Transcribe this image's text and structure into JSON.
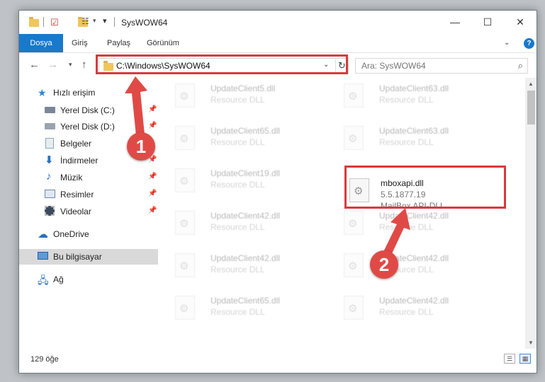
{
  "window": {
    "title": "SysWOW64",
    "minimize": "—",
    "maximize": "☐",
    "close": "✕"
  },
  "ribbon": {
    "tabs": [
      "Dosya",
      "Giriş",
      "Paylaş",
      "Görünüm"
    ],
    "help": "?",
    "expand": "⌄"
  },
  "address": {
    "path": "C:\\Windows\\SysWOW64",
    "search_placeholder": "Ara: SysWOW64"
  },
  "nav": {
    "items": [
      {
        "label": "Hızlı erişim",
        "icon": "star-icon"
      },
      {
        "label": "Yerel Disk (C:)",
        "icon": "drive-icon"
      },
      {
        "label": "Yerel Disk (D:)",
        "icon": "drive-icon"
      },
      {
        "label": "Belgeler",
        "icon": "documents-icon"
      },
      {
        "label": "İndirmeler",
        "icon": "download-icon"
      },
      {
        "label": "Müzik",
        "icon": "music-icon"
      },
      {
        "label": "Resimler",
        "icon": "pictures-icon"
      },
      {
        "label": "Videolar",
        "icon": "video-icon"
      },
      {
        "label": "OneDrive",
        "icon": "cloud-icon"
      },
      {
        "label": "Bu bilgisayar",
        "icon": "computer-icon"
      },
      {
        "label": "Ağ",
        "icon": "network-icon"
      }
    ]
  },
  "files": {
    "left": [
      {
        "name": "UpdateClient5.dll",
        "desc": "Resource DLL"
      },
      {
        "name": "UpdateClient65.dll",
        "desc": "Resource DLL"
      },
      {
        "name": "UpdateClient19.dll",
        "desc": "Resource DLL"
      },
      {
        "name": "UpdateClient42.dll",
        "desc": "Resource DLL"
      },
      {
        "name": "UpdateClient42.dll",
        "desc": "Resource DLL"
      },
      {
        "name": "UpdateClient65.dll",
        "desc": "Resource DLL"
      }
    ],
    "right": [
      {
        "name": "UpdateClient63.dll",
        "desc": "Resource DLL"
      },
      {
        "name": "UpdateClient63.dll",
        "desc": "Resource DLL"
      },
      {
        "name": "mboxapi.dll",
        "version": "5.5.1877.19",
        "desc": "MailBox API-DLL"
      },
      {
        "name": "UpdateClient42.dll",
        "desc": "Resource DLL"
      },
      {
        "name": "UpdateClient42.dll",
        "desc": "Resource DLL"
      },
      {
        "name": "UpdateClient42.dll",
        "desc": "Resource DLL"
      }
    ]
  },
  "status": {
    "count": "129 öğe"
  },
  "annotations": {
    "badge1": "1",
    "badge2": "2",
    "color": "#d73b3b"
  }
}
